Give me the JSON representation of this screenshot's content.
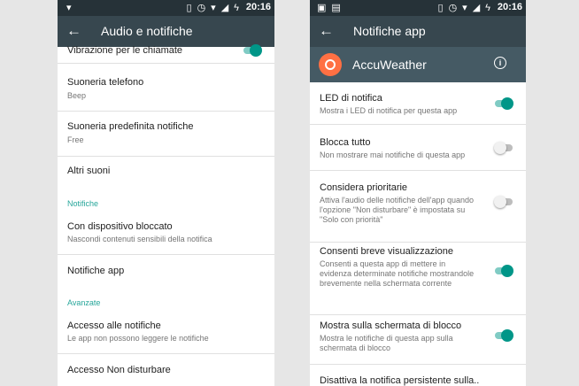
{
  "status": {
    "time": "20:16"
  },
  "left": {
    "title": "Audio e notifiche",
    "items": [
      {
        "title": "Vibrazione per le chiamate"
      },
      {
        "title": "Suoneria telefono",
        "subtitle": "Beep"
      },
      {
        "title": "Suoneria predefinita notifiche",
        "subtitle": "Free"
      },
      {
        "title": "Altri suoni"
      },
      {
        "title": "Con dispositivo bloccato",
        "subtitle": "Nascondi contenuti sensibili della notifica"
      },
      {
        "title": "Notifiche app"
      },
      {
        "title": "Accesso alle notifiche",
        "subtitle": "Le app non possono leggere le notifiche"
      },
      {
        "title": "Accesso Non disturbare"
      }
    ],
    "sections": [
      "Notifiche",
      "Avanzate"
    ]
  },
  "right": {
    "title": "Notifiche app",
    "app_name": "AccuWeather",
    "settings": [
      {
        "title": "LED di notifica",
        "subtitle": "Mostra i LED di notifica per questa app",
        "enabled": true
      },
      {
        "title": "Blocca tutto",
        "subtitle": "Non mostrare mai notifiche di questa app",
        "enabled": false
      },
      {
        "title": "Considera prioritarie",
        "subtitle": "Attiva l'audio delle notifiche dell'app quando l'opzione \"Non disturbare\" è impostata su \"Solo con priorità\"",
        "enabled": false
      },
      {
        "title": "Consenti breve visualizzazione",
        "subtitle": "Consenti a questa app di mettere in evidenza determinate notifiche mostrandole brevemente nella schermata corrente",
        "enabled": true
      },
      {
        "title": "Mostra sulla schermata di blocco",
        "subtitle": "Mostra le notifiche di questa app sulla schermata di blocco",
        "enabled": true
      },
      {
        "title": "Disattiva la notifica persistente sulla.."
      }
    ]
  },
  "colors": {
    "accent": "#009688",
    "toolbar": "#37474f",
    "statusbar": "#263238",
    "appbar": "#455a64"
  }
}
